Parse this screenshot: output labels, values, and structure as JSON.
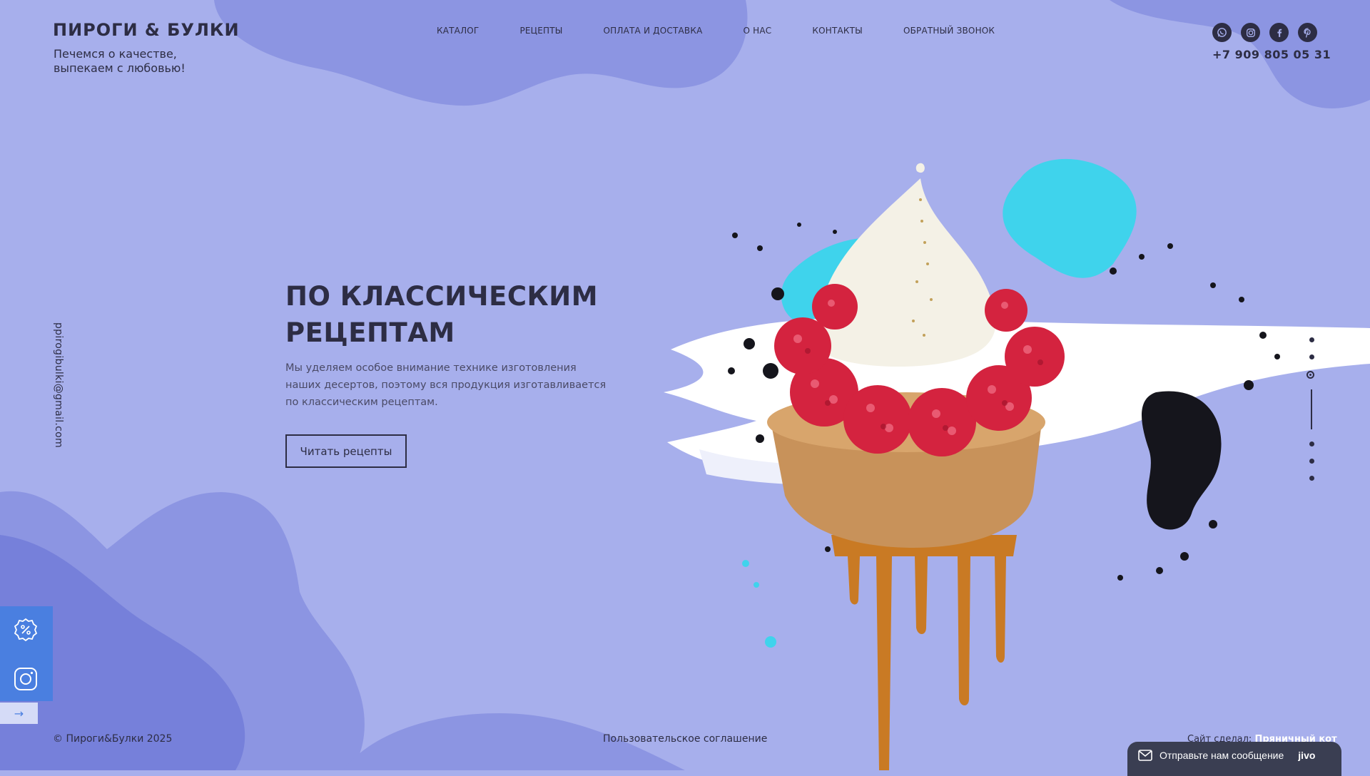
{
  "header": {
    "logo": "ПИРОГИ & БУЛКИ",
    "tagline": "Печемся о качестве, выпекаем с любовью!",
    "phone": "+7 909 805 05 31",
    "nav": [
      "КАТАЛОГ",
      "РЕЦЕПТЫ",
      "ОПЛАТА И ДОСТАВКА",
      "О НАС",
      "КОНТАКТЫ",
      "ОБРАТНЫЙ ЗВОНОК"
    ],
    "socials": [
      "whatsapp-icon",
      "instagram-icon",
      "facebook-icon",
      "pinterest-icon"
    ]
  },
  "email": "ppirogibulki@gmail.com",
  "hero": {
    "title": "ПО КЛАССИЧЕСКИМ РЕЦЕПТАМ",
    "text": "Мы уделяем особое внимание технике изготовления наших десертов, поэтому вся продукция изготавливается по классическим рецептам.",
    "button": "Читать рецепты",
    "image": "raspberry-tart-image"
  },
  "slider": {
    "active_index": 0
  },
  "side_widget": {
    "icons": [
      "discount-icon",
      "instagram-icon"
    ],
    "toggle_icon": "→"
  },
  "footer": {
    "copyright": "© Пироги&Булки 2025",
    "agreement": "Пользовательское соглашение",
    "made_by_label": "Сайт сделал:",
    "made_by_name": "Пряничный кот"
  },
  "chat": {
    "label": "Отправьте нам сообщение",
    "brand": "jivo"
  },
  "colors": {
    "background": "#a7afec",
    "blob": "#8c95e2",
    "text": "#2d2d44",
    "accent_blue": "#4a7fe0",
    "cyan": "#3fd3ec",
    "raspberry": "#d4233f"
  }
}
